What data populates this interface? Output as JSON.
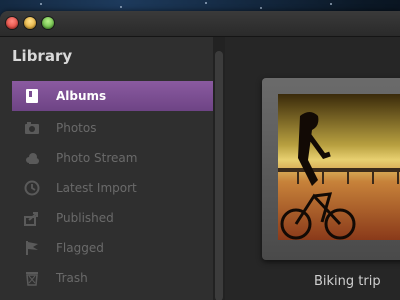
{
  "sidebar": {
    "title": "Library",
    "items": [
      {
        "label": "Albums",
        "icon": "album-icon",
        "active": true
      },
      {
        "label": "Photos",
        "icon": "camera-icon",
        "active": false
      },
      {
        "label": "Photo Stream",
        "icon": "cloud-icon",
        "active": false
      },
      {
        "label": "Latest Import",
        "icon": "clock-icon",
        "active": false
      },
      {
        "label": "Published",
        "icon": "share-icon",
        "active": false
      },
      {
        "label": "Flagged",
        "icon": "flag-icon",
        "active": false
      },
      {
        "label": "Trash",
        "icon": "trash-icon",
        "active": false
      }
    ]
  },
  "album": {
    "caption": "Biking trip"
  },
  "colors": {
    "accent": "#7b4e92",
    "sidebar_bg": "#2f2f2f",
    "main_bg": "#262626"
  }
}
